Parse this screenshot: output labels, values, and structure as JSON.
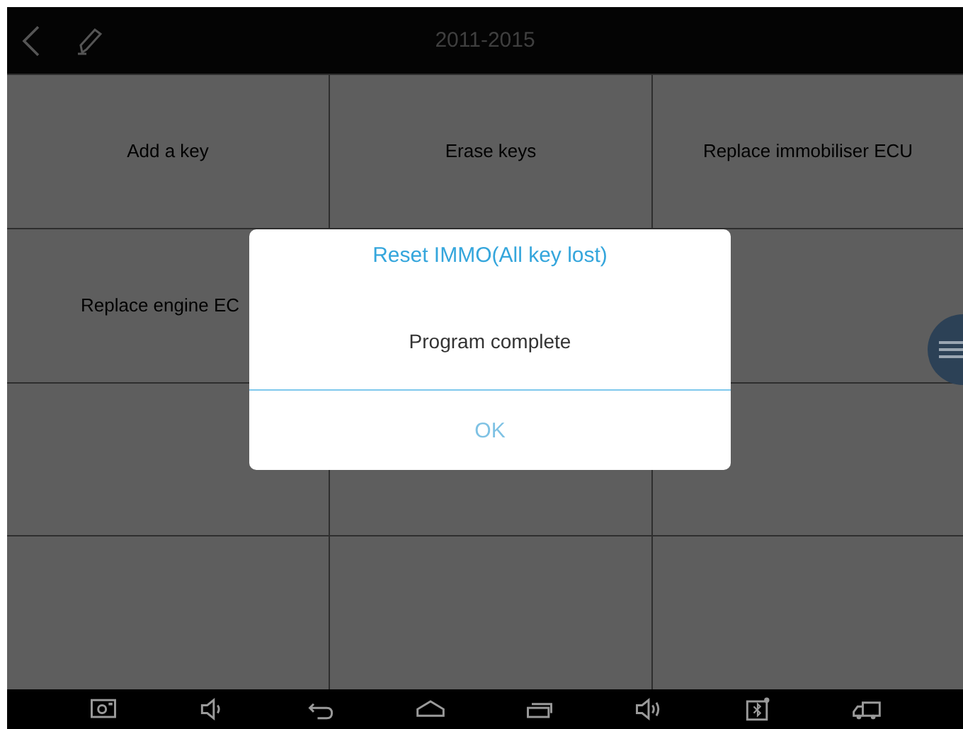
{
  "header": {
    "title": "2011-2015"
  },
  "functions": [
    {
      "label": "Add a key"
    },
    {
      "label": "Erase keys"
    },
    {
      "label": "Replace immobiliser ECU"
    },
    {
      "label": "Replace engine EC"
    }
  ],
  "dialog": {
    "title": "Reset IMMO(All key lost)",
    "message": "Program complete",
    "button": "OK"
  }
}
